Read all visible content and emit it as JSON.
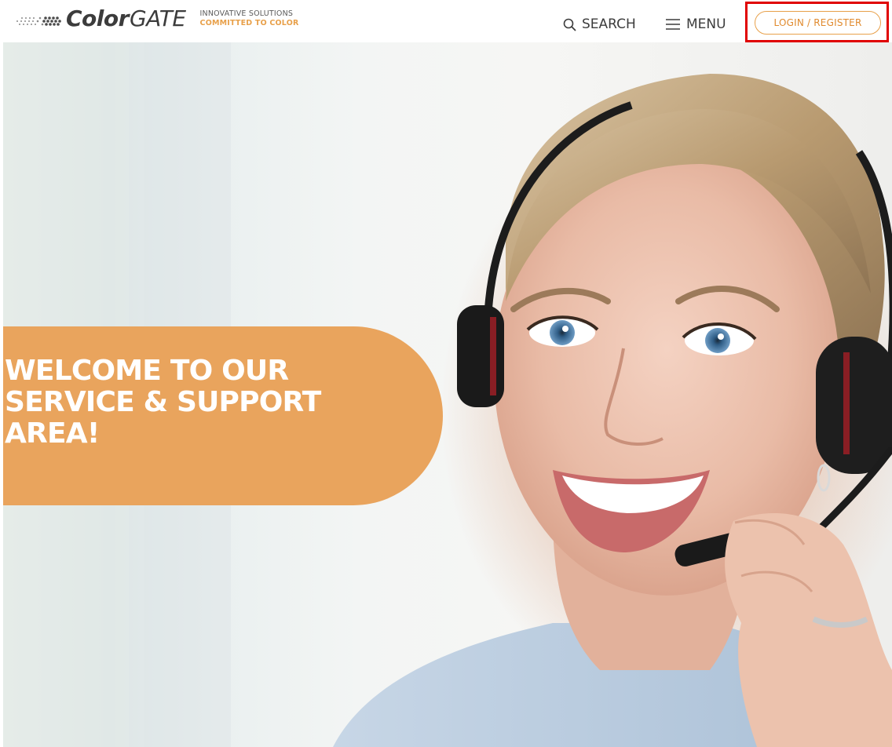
{
  "header": {
    "logo": {
      "brand_bold": "Color",
      "brand_light": "GATE",
      "tagline_line1": "INNOVATIVE SOLUTIONS",
      "tagline_line2": "COMMITTED TO COLOR"
    },
    "nav": {
      "search_label": "SEARCH",
      "search_icon": "search-icon",
      "menu_label": "MENU",
      "menu_icon": "hamburger-icon"
    },
    "login_button_label": "LOGIN / REGISTER"
  },
  "hero": {
    "welcome_text": "WELCOME TO OUR\nSERVICE & SUPPORT\nAREA!",
    "image_subject": "support-agent-with-headset-photo"
  },
  "colors": {
    "accent_orange": "#e9a45d",
    "login_border": "#e8a04a",
    "highlight_red": "#e00000",
    "text_dark": "#3c3c3c"
  }
}
